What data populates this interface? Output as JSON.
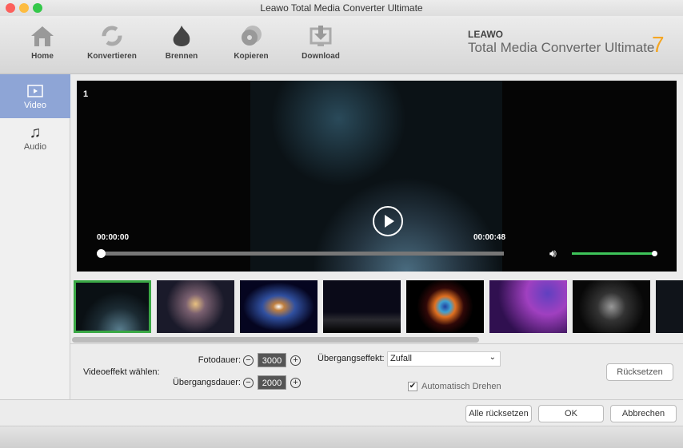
{
  "window": {
    "title": "Leawo Total Media Converter Ultimate"
  },
  "toolbar": {
    "items": [
      {
        "label": "Home",
        "icon": "home-icon"
      },
      {
        "label": "Konvertieren",
        "icon": "convert-icon"
      },
      {
        "label": "Brennen",
        "icon": "burn-icon"
      },
      {
        "label": "Kopieren",
        "icon": "copy-disc-icon"
      },
      {
        "label": "Download",
        "icon": "download-icon"
      }
    ]
  },
  "brand": {
    "logo": "LEAWO",
    "product": "Total Media Converter Ultimate",
    "version": "7"
  },
  "sidebar": {
    "items": [
      {
        "label": "Video",
        "active": true
      },
      {
        "label": "Audio",
        "active": false
      }
    ]
  },
  "player": {
    "index": "1",
    "time_current": "00:00:00",
    "time_total": "00:00:48",
    "progress": 0,
    "volume": 1.0
  },
  "settings": {
    "effect_label": "Videoeffekt wählen:",
    "photo_duration_label": "Fotodauer:",
    "photo_duration": "3000",
    "transition_duration_label": "Übergangsdauer:",
    "transition_duration": "2000",
    "transition_effect_label": "Übergangseffekt:",
    "transition_effect": "Zufall",
    "auto_rotate_label": "Automatisch Drehen",
    "auto_rotate": true,
    "reset_label": "Rücksetzen"
  },
  "buttons": {
    "reset_all": "Alle rücksetzen",
    "ok": "OK",
    "cancel": "Abbrechen"
  },
  "colors": {
    "accent": "#8ea5d6",
    "volume": "#3ec55a",
    "selected_thumb": "#3aa845"
  }
}
